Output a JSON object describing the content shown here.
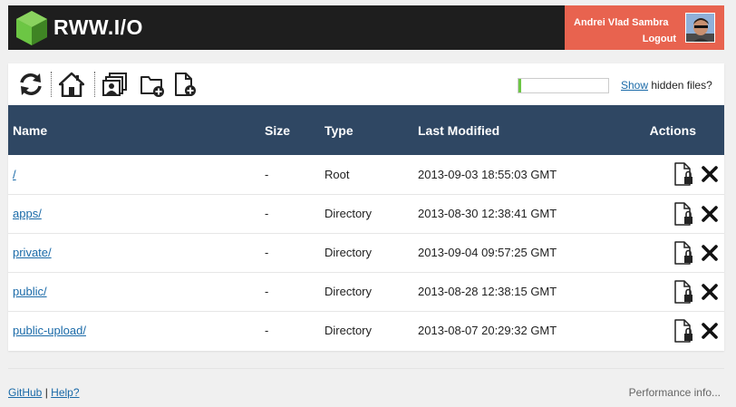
{
  "header": {
    "brand": "RWW.I/O",
    "user_name": "Andrei Vlad Sambra",
    "logout_label": "Logout",
    "colors": {
      "topbar": "#1e1e1e",
      "userbox": "#e8634f",
      "logo": "#6cc644"
    }
  },
  "toolbar": {
    "icons": [
      "refresh-icon",
      "home-icon",
      "gallery-icon",
      "new-folder-icon",
      "new-file-icon"
    ],
    "progress_fraction": 0.03,
    "show_link": "Show",
    "hidden_files_text": "hidden files?"
  },
  "table": {
    "headers": {
      "name": "Name",
      "size": "Size",
      "type": "Type",
      "modified": "Last Modified",
      "actions": "Actions"
    },
    "header_color": "#2f4763",
    "rows": [
      {
        "name": "/",
        "size": "-",
        "type": "Root",
        "modified": "2013-09-03 18:55:03 GMT"
      },
      {
        "name": "apps/",
        "size": "-",
        "type": "Directory",
        "modified": "2013-08-30 12:38:41 GMT"
      },
      {
        "name": "private/",
        "size": "-",
        "type": "Directory",
        "modified": "2013-09-04 09:57:25 GMT"
      },
      {
        "name": "public/",
        "size": "-",
        "type": "Directory",
        "modified": "2013-08-28 12:38:15 GMT"
      },
      {
        "name": "public-upload/",
        "size": "-",
        "type": "Directory",
        "modified": "2013-08-07 20:29:32 GMT"
      }
    ]
  },
  "footer": {
    "github": "GitHub",
    "separator": "|",
    "help": "Help?",
    "performance": "Performance info..."
  }
}
